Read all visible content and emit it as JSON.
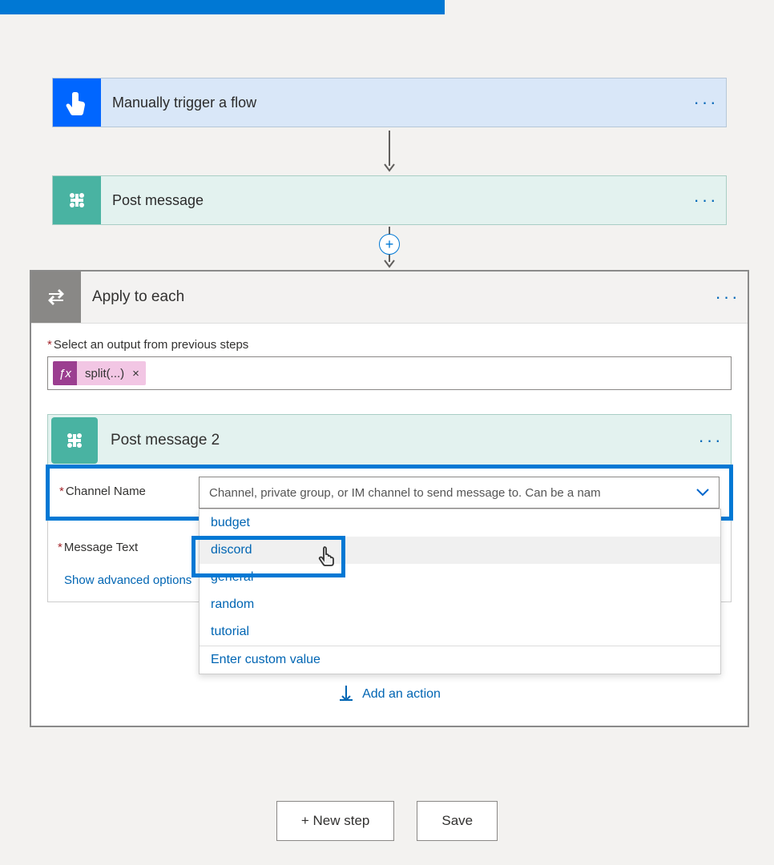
{
  "trigger": {
    "title": "Manually trigger a flow"
  },
  "post1": {
    "title": "Post message"
  },
  "each": {
    "title": "Apply to each",
    "select_label": "Select an output from previous steps",
    "token_label": "split(...)"
  },
  "post2": {
    "title": "Post message 2",
    "channel_label": "Channel Name",
    "channel_placeholder": "Channel, private group, or IM channel to send message to. Can be a nam",
    "message_label": "Message Text",
    "advanced": "Show advanced options",
    "options": [
      "budget",
      "discord",
      "general",
      "random",
      "tutorial"
    ],
    "custom": "Enter custom value"
  },
  "add_action": "Add an action",
  "buttons": {
    "new_step": "+ New step",
    "save": "Save"
  }
}
